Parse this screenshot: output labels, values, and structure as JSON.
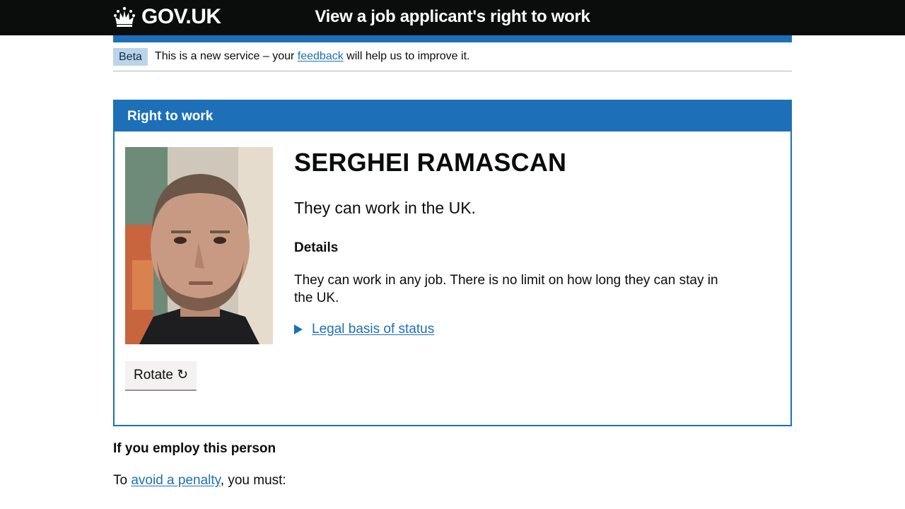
{
  "header": {
    "logo_text": "GOV.UK",
    "service_name": "View a job applicant's right to work"
  },
  "phase_banner": {
    "tag": "Beta",
    "text_before": "This is a new service – your ",
    "link": "feedback",
    "text_after": " will help us to improve it."
  },
  "panel": {
    "title": "Right to work",
    "name": "SERGHEI RAMASCAN",
    "status": "They can work in the UK.",
    "details_heading": "Details",
    "details_text": "They can work in any job. There is no limit on how long they can stay in the UK.",
    "legal_link": "Legal basis of status",
    "rotate_button": "Rotate ↻"
  },
  "employ": {
    "heading": "If you employ this person",
    "text_before": "To ",
    "link": "avoid a penalty",
    "text_after": ", you must:"
  },
  "colors": {
    "header_bg": "#0b0c0c",
    "brand_blue": "#1d70b8",
    "beta_tag_bg": "#bbd4ea"
  }
}
